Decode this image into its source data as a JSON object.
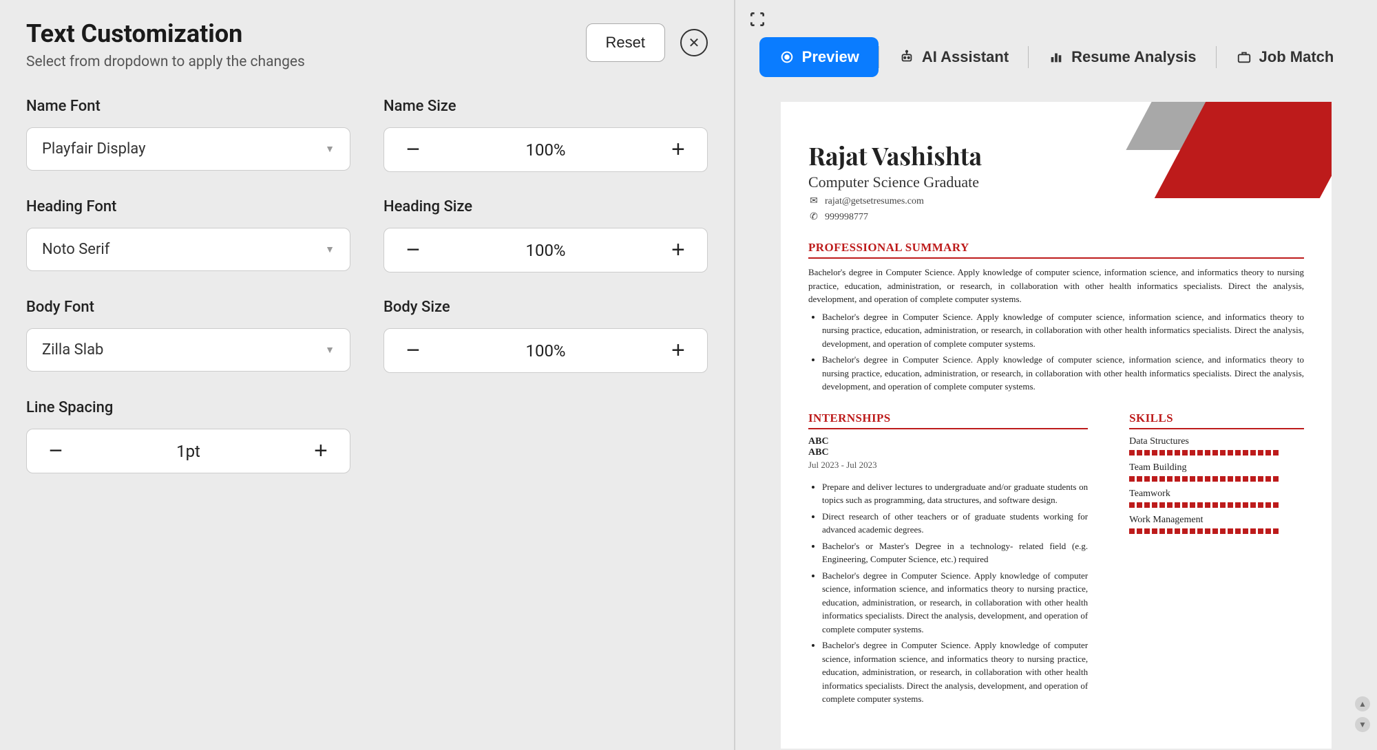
{
  "panel": {
    "title": "Text Customization",
    "subtitle": "Select from dropdown to apply the changes",
    "reset": "Reset"
  },
  "fields": {
    "nameFont": {
      "label": "Name Font",
      "value": "Playfair Display"
    },
    "nameSize": {
      "label": "Name Size",
      "value": "100%"
    },
    "headingFont": {
      "label": "Heading Font",
      "value": "Noto Serif"
    },
    "headingSize": {
      "label": "Heading Size",
      "value": "100%"
    },
    "bodyFont": {
      "label": "Body Font",
      "value": "Zilla Slab"
    },
    "bodySize": {
      "label": "Body Size",
      "value": "100%"
    },
    "lineSpacing": {
      "label": "Line Spacing",
      "value": "1pt"
    }
  },
  "tabs": {
    "preview": "Preview",
    "ai": "AI Assistant",
    "analysis": "Resume Analysis",
    "jobmatch": "Job Match"
  },
  "resume": {
    "name": "Rajat Vashishta",
    "role": "Computer Science Graduate",
    "email": "rajat@getsetresumes.com",
    "phone": "999998777",
    "sections": {
      "summary": {
        "title": "PROFESSIONAL SUMMARY",
        "text": "Bachelor's degree in Computer Science. Apply knowledge of computer science, information science, and informatics theory to nursing practice, education, administration, or research, in collaboration with other health informatics specialists. Direct the analysis, development, and operation of complete computer systems.",
        "bullets": [
          "Bachelor's degree in Computer Science. Apply knowledge of computer science, information science, and informatics theory to nursing practice, education, administration, or research, in collaboration with other health informatics specialists. Direct the analysis, development, and operation of complete computer systems.",
          "Bachelor's degree in Computer Science. Apply knowledge of computer science, information science, and informatics theory to nursing practice, education, administration, or research, in collaboration with other health informatics specialists. Direct the analysis, development, and operation of complete computer systems."
        ]
      },
      "internships": {
        "title": "INTERNSHIPS",
        "company": "ABC",
        "role": "ABC",
        "dates": "Jul 2023 - Jul 2023",
        "bullets": [
          "Prepare and deliver lectures to undergraduate and/or graduate students on topics such as programming, data structures, and software design.",
          "Direct research of other teachers or of graduate students working for advanced academic degrees.",
          "Bachelor's or Master's Degree in a technology- related field (e.g. Engineering, Computer Science, etc.) required",
          "Bachelor's degree in Computer Science. Apply knowledge of computer science, information science, and informatics theory to nursing practice, education, administration, or research, in collaboration with other health informatics specialists. Direct the analysis, development, and operation of complete computer systems.",
          " Bachelor's degree in Computer Science. Apply knowledge of computer science, information science, and informatics theory to nursing practice, education, administration, or research, in collaboration with other health informatics specialists. Direct the analysis, development, and operation of complete computer systems."
        ]
      },
      "skills": {
        "title": "SKILLS",
        "items": [
          "Data Structures",
          "Team Building",
          "Teamwork",
          "Work Management"
        ]
      }
    }
  }
}
